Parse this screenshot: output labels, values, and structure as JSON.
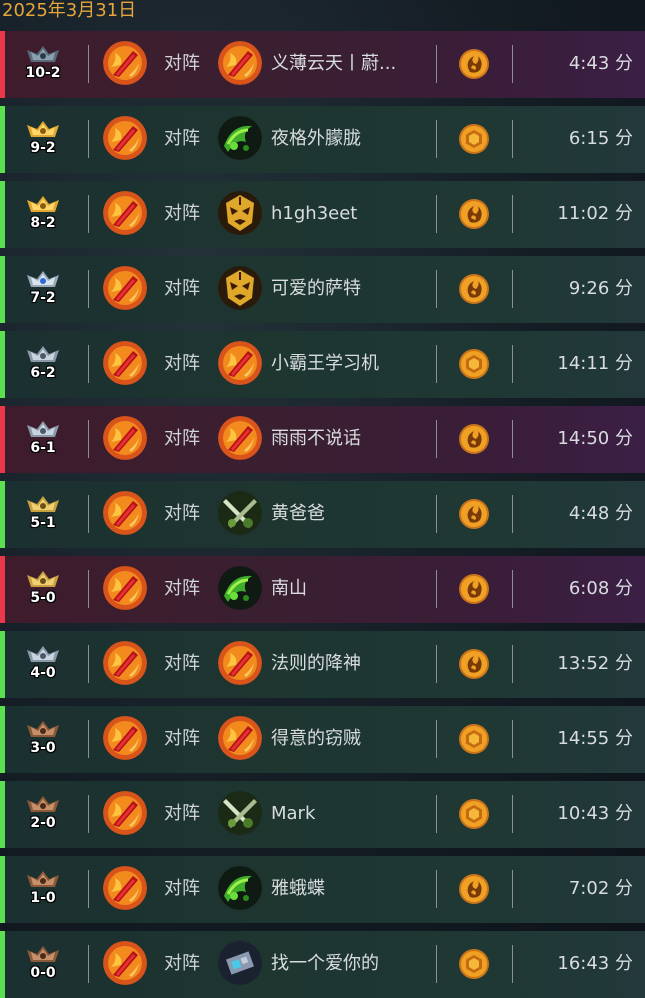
{
  "date_header": "2025年3月31日",
  "colors": {
    "date": "#e8a53a",
    "loss_bar": "#e8384a",
    "win_bar": "#5de04f",
    "coin": "#f0a024"
  },
  "matches": [
    {
      "result": "loss",
      "rank": "10-2",
      "rank_icon": "rank-badge-diamond-icon",
      "mode": "对阵",
      "opponent": "义薄云天丨蔚...",
      "opp_avatar": "fire-feather-avatar",
      "coin_icon": "flame-coin-icon",
      "duration": "4:43 分"
    },
    {
      "result": "win",
      "rank": "9-2",
      "rank_icon": "rank-badge-gold-crown-icon",
      "mode": "对阵",
      "opponent": "夜格外朦胧",
      "opp_avatar": "green-void-avatar",
      "coin_icon": "hex-coin-icon",
      "duration": "6:15 分"
    },
    {
      "result": "win",
      "rank": "8-2",
      "rank_icon": "rank-badge-gold-crown-icon",
      "mode": "对阵",
      "opponent": "h1gh3eet",
      "opp_avatar": "shaman-mask-avatar",
      "coin_icon": "flame-coin-icon",
      "duration": "11:02 分"
    },
    {
      "result": "win",
      "rank": "7-2",
      "rank_icon": "rank-badge-blue-gem-icon",
      "mode": "对阵",
      "opponent": "可爱的萨特",
      "opp_avatar": "shaman-mask-avatar",
      "coin_icon": "flame-coin-icon",
      "duration": "9:26 分"
    },
    {
      "result": "win",
      "rank": "6-2",
      "rank_icon": "rank-badge-silver-icon",
      "mode": "对阵",
      "opponent": "小霸王学习机",
      "opp_avatar": "fire-feather-avatar",
      "coin_icon": "hex-coin-icon",
      "duration": "14:11 分"
    },
    {
      "result": "loss",
      "rank": "6-1",
      "rank_icon": "rank-badge-silver-icon",
      "mode": "对阵",
      "opponent": "雨雨不说话",
      "opp_avatar": "fire-feather-avatar",
      "coin_icon": "flame-coin-icon",
      "duration": "14:50 分"
    },
    {
      "result": "win",
      "rank": "5-1",
      "rank_icon": "rank-badge-gold-icon",
      "mode": "对阵",
      "opponent": "黄爸爸",
      "opp_avatar": "swords-avatar",
      "coin_icon": "flame-coin-icon",
      "duration": "4:48 分"
    },
    {
      "result": "loss",
      "rank": "5-0",
      "rank_icon": "rank-badge-gold-icon",
      "mode": "对阵",
      "opponent": "南山",
      "opp_avatar": "green-void-avatar",
      "coin_icon": "flame-coin-icon",
      "duration": "6:08 分"
    },
    {
      "result": "win",
      "rank": "4-0",
      "rank_icon": "rank-badge-silver-icon",
      "mode": "对阵",
      "opponent": "法则的降神",
      "opp_avatar": "fire-feather-avatar",
      "coin_icon": "flame-coin-icon",
      "duration": "13:52 分"
    },
    {
      "result": "win",
      "rank": "3-0",
      "rank_icon": "rank-badge-bronze-icon",
      "mode": "对阵",
      "opponent": "得意的窃贼",
      "opp_avatar": "fire-feather-avatar",
      "coin_icon": "hex-coin-icon",
      "duration": "14:55 分"
    },
    {
      "result": "win",
      "rank": "2-0",
      "rank_icon": "rank-badge-bronze-icon",
      "mode": "对阵",
      "opponent": "Mark",
      "opp_avatar": "swords-avatar",
      "coin_icon": "hex-coin-icon",
      "duration": "10:43 分"
    },
    {
      "result": "win",
      "rank": "1-0",
      "rank_icon": "rank-badge-bronze-icon",
      "mode": "对阵",
      "opponent": "雅蛾蝶",
      "opp_avatar": "green-void-avatar",
      "coin_icon": "flame-coin-icon",
      "duration": "7:02 分"
    },
    {
      "result": "win",
      "rank": "0-0",
      "rank_icon": "rank-badge-bronze-icon",
      "mode": "对阵",
      "opponent": "找一个爱你的",
      "opp_avatar": "mech-avatar",
      "coin_icon": "hex-coin-icon",
      "duration": "16:43 分"
    }
  ]
}
